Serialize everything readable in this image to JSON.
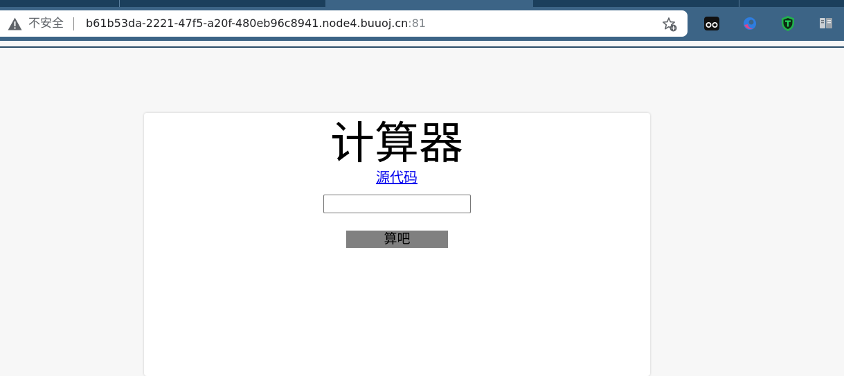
{
  "browser": {
    "security_label": "不安全",
    "url_host": "b61b53da-2221-47f5-a20f-480eb96c8941.node4.buuoj.cn",
    "url_port": ":81",
    "icons": [
      "warning-icon",
      "bookmark-star-icon",
      "extension-goggles-icon",
      "extension-edge-icon",
      "extension-shield-icon",
      "extension-reader-icon"
    ]
  },
  "page": {
    "title": "计算器",
    "source_link": "源代码",
    "expression_input_value": "",
    "submit_label": "算吧"
  },
  "colors": {
    "chrome": "#3c6486",
    "page_background": "#f7f7f7",
    "card_background": "#ffffff",
    "button": "#808080",
    "link": "#0000ee"
  }
}
